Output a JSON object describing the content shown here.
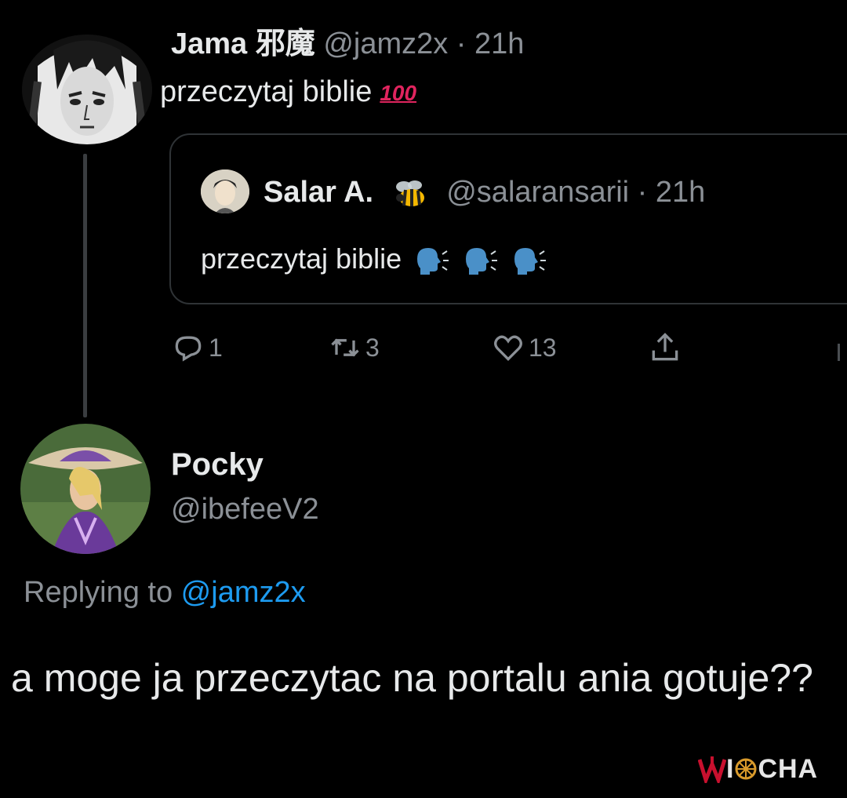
{
  "original_tweet": {
    "author_name": "Jama 邪魔",
    "handle_time": "@jamz2x · 21h",
    "text": "przeczytaj biblie",
    "emoji": "100-emoji",
    "emoji_text": "100"
  },
  "quoted_tweet": {
    "author_name": "Salar A.",
    "author_emoji": "bee-icon",
    "handle_time": "@salaransarii · 21h",
    "text": "przeczytaj biblie",
    "emoji": "speaking-head-icon"
  },
  "actions": {
    "reply_count": "1",
    "retweet_count": "3",
    "like_count": "13",
    "icons": [
      "reply-icon",
      "retweet-icon",
      "like-icon",
      "share-icon"
    ]
  },
  "reply": {
    "author_name": "Pocky",
    "handle": "@ibefeeV2",
    "replying_prefix": "Replying to ",
    "replying_to": "@jamz2x",
    "text": "a moge ja przeczytac na portalu ania gotuje??"
  },
  "watermark": {
    "text_before": "I",
    "text_after": "CHA",
    "logo": "wiocha-logo"
  },
  "colors": {
    "background": "#000000",
    "primary_text": "#e7e9ea",
    "secondary_text": "#8b9096",
    "link": "#1d9bf0",
    "border": "#2f3336",
    "emoji_red": "#e0245e",
    "watermark_red": "#c8102e"
  }
}
